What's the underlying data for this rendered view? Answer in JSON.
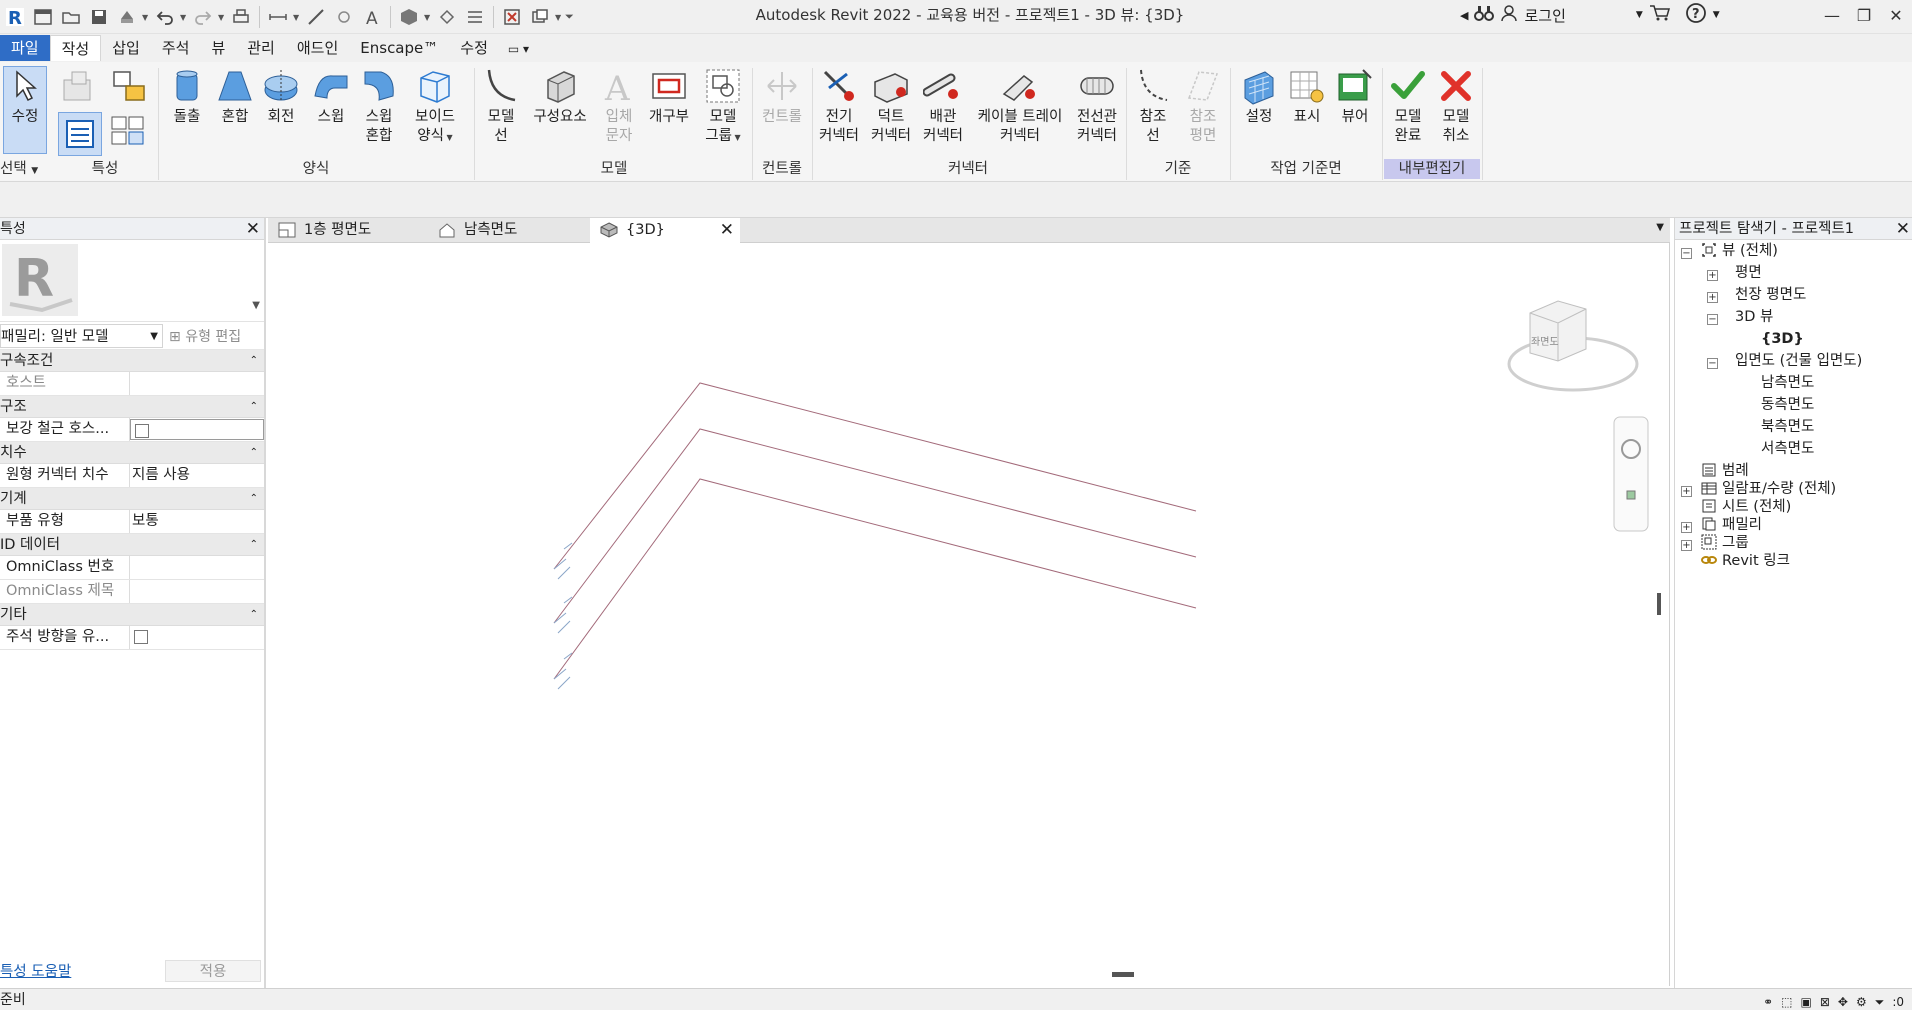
{
  "title": "Autodesk Revit 2022 - 교육용 버전 - 프로젝트1 - 3D 뷰: {3D}",
  "account": {
    "login_label": "로그인"
  },
  "menu_tabs": [
    "파일",
    "작성",
    "삽입",
    "주석",
    "뷰",
    "관리",
    "애드인",
    "Enscape™",
    "수정"
  ],
  "ribbon": {
    "select_label": "선택",
    "modify": "수정",
    "panels": {
      "properties": "특성",
      "forms": "양식",
      "model": "모델",
      "control": "컨트롤",
      "connectors": "커넥터",
      "datum": "기준",
      "work_plane": "작업 기준면",
      "in_place_editor": "내부편집기"
    },
    "buttons": {
      "extrusion": "돌출",
      "blend": "혼합",
      "revolve": "회전",
      "sweep": "스윕",
      "swept_blend_1": "스윕",
      "swept_blend_2": "혼합",
      "void_1": "보이드",
      "void_2": "양식",
      "model_line_1": "모델",
      "model_line_2": "선",
      "component": "구성요소",
      "model_text_1": "입체",
      "model_text_2": "문자",
      "opening": "개구부",
      "model_group_1": "모델",
      "model_group_2": "그룹",
      "control": "컨트롤",
      "elec_conn_1": "전기",
      "elec_conn_2": "커넥터",
      "duct_conn_1": "덕트",
      "duct_conn_2": "커넥터",
      "pipe_conn_1": "배관",
      "pipe_conn_2": "커넥터",
      "tray_conn_1": "케이블 트레이",
      "tray_conn_2": "커넥터",
      "conduit_conn_1": "전선관",
      "conduit_conn_2": "커넥터",
      "ref_line_1": "참조",
      "ref_line_2": "선",
      "ref_plane_1": "참조",
      "ref_plane_2": "평면",
      "set": "설정",
      "show": "표시",
      "viewer": "뷰어",
      "finish_1": "모델",
      "finish_2": "완료",
      "cancel_1": "모델",
      "cancel_2": "취소"
    }
  },
  "properties": {
    "header": "특성",
    "family": "패밀리: 일반 모델",
    "edit_type": "유형 편집",
    "groups": [
      {
        "name": "구속조건",
        "rows": [
          {
            "k": "호스트",
            "v": "",
            "grey": true
          }
        ]
      },
      {
        "name": "구조",
        "rows": [
          {
            "k": "보강 철근 호스...",
            "v": "",
            "check": true
          }
        ]
      },
      {
        "name": "치수",
        "rows": [
          {
            "k": "원형 커넥터 치수",
            "v": "지름 사용"
          }
        ]
      },
      {
        "name": "기계",
        "rows": [
          {
            "k": "부품 유형",
            "v": "보통"
          }
        ]
      },
      {
        "name": "ID 데이터",
        "rows": [
          {
            "k": "OmniClass 번호",
            "v": ""
          },
          {
            "k": "OmniClass 제목",
            "v": "",
            "grey": true
          }
        ]
      },
      {
        "name": "기타",
        "rows": [
          {
            "k": "주석 방향을 유...",
            "v": "",
            "check": true
          }
        ]
      }
    ],
    "help_link": "특성 도움말",
    "apply": "적용"
  },
  "view_tabs": [
    {
      "label": "1층 평면도",
      "icon": "floor-plan-icon"
    },
    {
      "label": "남측면도",
      "icon": "elevation-icon"
    },
    {
      "label": "{3D}",
      "icon": "3d-view-icon",
      "active": true
    }
  ],
  "viewcube": {
    "face": "좌면도"
  },
  "browser": {
    "header": "프로젝트 탐색기 - 프로젝트1",
    "items": [
      {
        "label": "뷰 (전체)"
      },
      {
        "label": "평면"
      },
      {
        "label": "천장 평면도"
      },
      {
        "label": "3D 뷰"
      },
      {
        "label": "{3D}"
      },
      {
        "label": "입면도 (건물 입면도)"
      },
      {
        "label": "남측면도"
      },
      {
        "label": "동측면도"
      },
      {
        "label": "북측면도"
      },
      {
        "label": "서측면도"
      },
      {
        "label": "범례"
      },
      {
        "label": "일람표/수량 (전체)"
      },
      {
        "label": "시트 (전체)"
      },
      {
        "label": "패밀리"
      },
      {
        "label": "그룹"
      },
      {
        "label": "Revit 링크"
      }
    ]
  },
  "status": {
    "text": "준비",
    "filter_count": ":0"
  },
  "colors": {
    "file_tab": "#2f6dc6",
    "line_color": "#a36a7a",
    "accent_purple": "#c8c8ee"
  }
}
